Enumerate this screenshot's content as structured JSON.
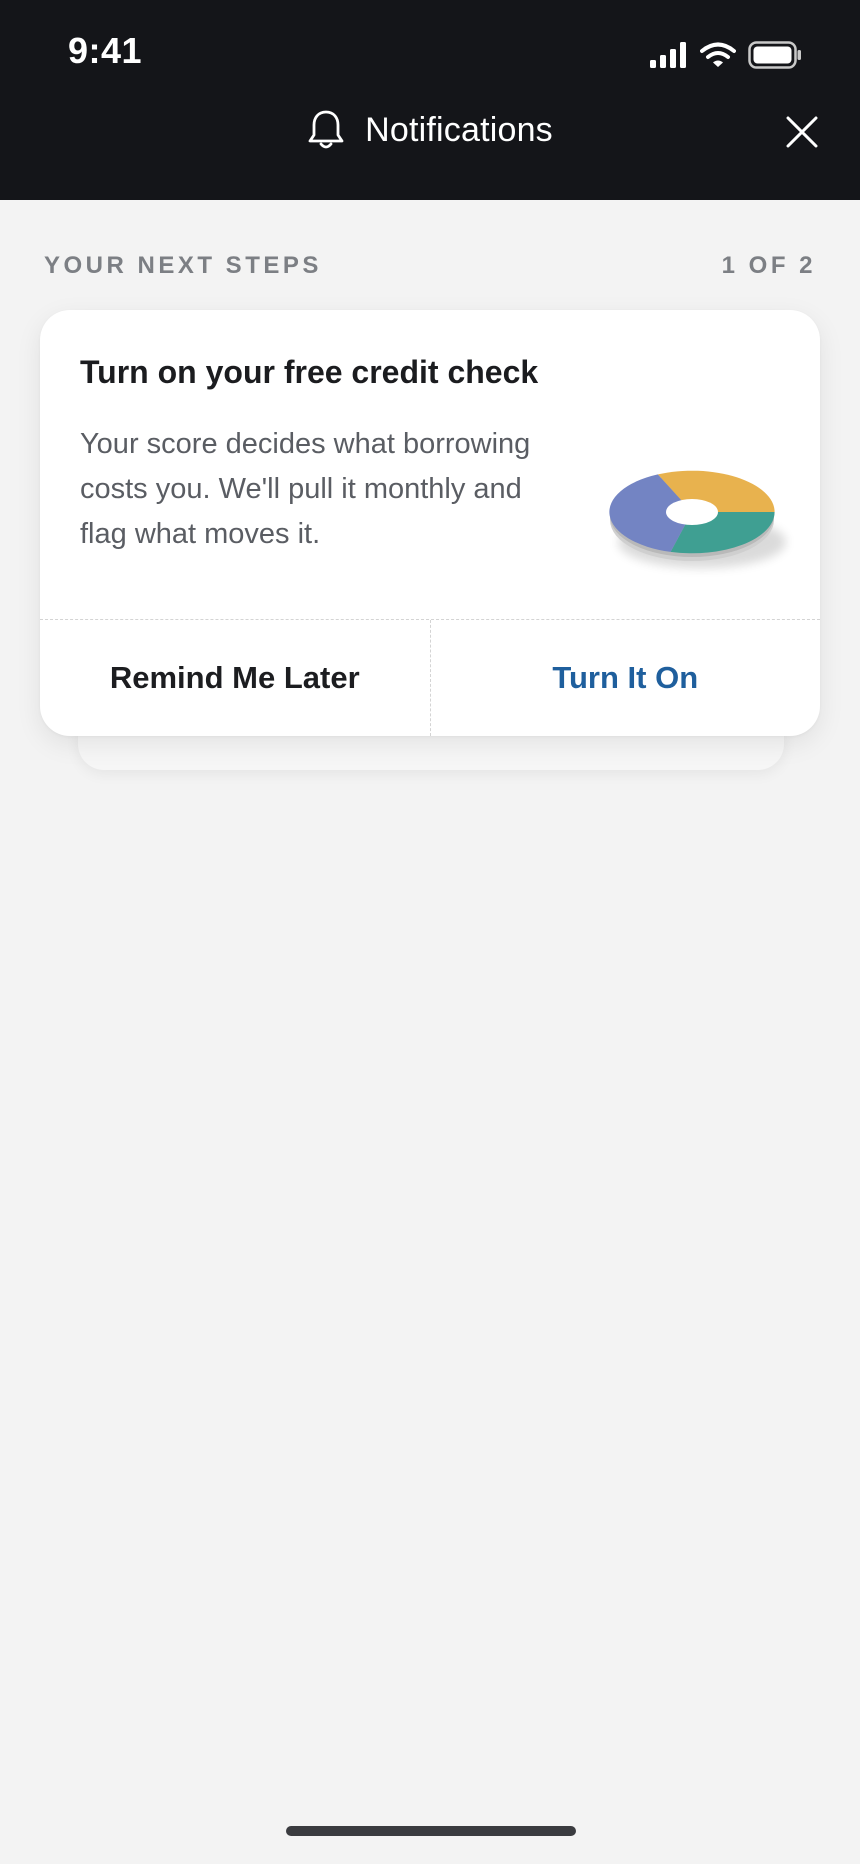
{
  "status_bar": {
    "time": "9:41"
  },
  "header": {
    "title": "Notifications",
    "title_icon": "bell-icon",
    "close_icon": "close-icon"
  },
  "section": {
    "label": "YOUR NEXT STEPS",
    "counter": "1 OF 2"
  },
  "card": {
    "title": "Turn on your free credit check",
    "body": "Your score decides what borrowing costs you. We'll pull it monthly and flag what moves it.",
    "illustration": "pie-chart-icon",
    "secondary_action": "Remind Me Later",
    "primary_action": "Turn It On"
  },
  "colors": {
    "header_bg": "#141519",
    "page_bg": "#f3f3f3",
    "primary_action": "#1f5f9d",
    "pie_purple": "#7384c3",
    "pie_yellow": "#e8b24e",
    "pie_teal": "#3f9f92"
  }
}
